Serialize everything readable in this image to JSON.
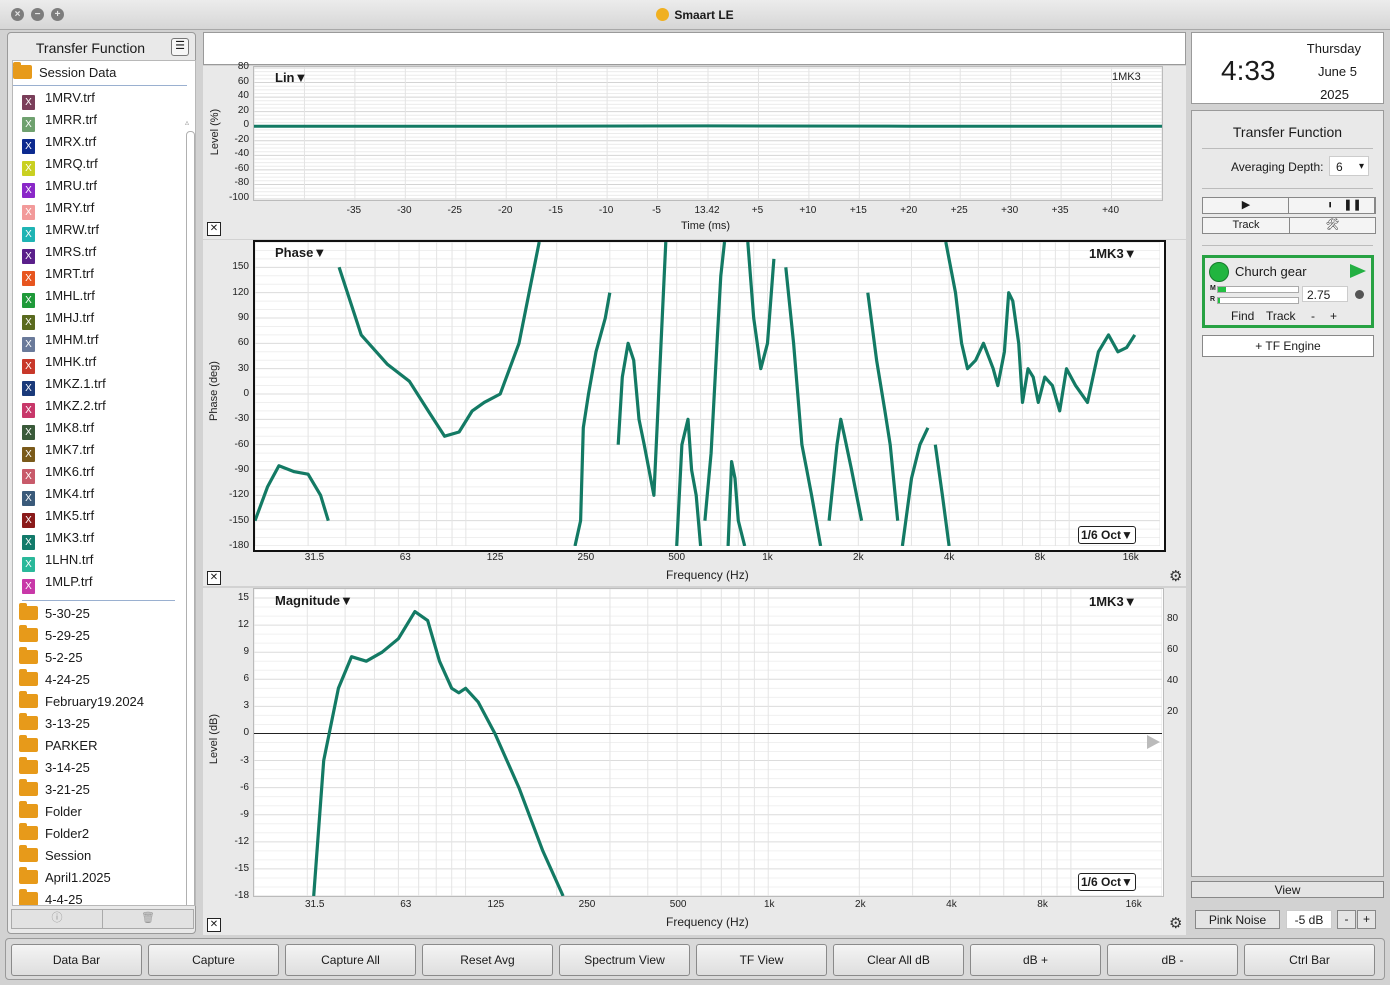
{
  "window": {
    "title": "Smaart LE"
  },
  "left_panel": {
    "title": "Transfer Function",
    "session_label": "Session Data",
    "files": [
      {
        "name": "1MRV.trf",
        "color": "#7a3e5a"
      },
      {
        "name": "1MRR.trf",
        "color": "#6fa16f"
      },
      {
        "name": "1MRX.trf",
        "color": "#0c2a8f"
      },
      {
        "name": "1MRQ.trf",
        "color": "#c9d021"
      },
      {
        "name": "1MRU.trf",
        "color": "#8a28c8"
      },
      {
        "name": "1MRY.trf",
        "color": "#f29a9a"
      },
      {
        "name": "1MRW.trf",
        "color": "#1fb4b4"
      },
      {
        "name": "1MRS.trf",
        "color": "#5a1f8a"
      },
      {
        "name": "1MRT.trf",
        "color": "#e7551f"
      },
      {
        "name": "1MHL.trf",
        "color": "#1f9a3a"
      },
      {
        "name": "1MHJ.trf",
        "color": "#5a6a1f"
      },
      {
        "name": "1MHM.trf",
        "color": "#6a7a9a"
      },
      {
        "name": "1MHK.trf",
        "color": "#c8382a"
      },
      {
        "name": "1MKZ.1.trf",
        "color": "#1a3a7a"
      },
      {
        "name": "1MKZ.2.trf",
        "color": "#c8386a"
      },
      {
        "name": "1MK8.trf",
        "color": "#3a5a3a"
      },
      {
        "name": "1MK7.trf",
        "color": "#7a5a1a"
      },
      {
        "name": "1MK6.trf",
        "color": "#c85a6a"
      },
      {
        "name": "1MK4.trf",
        "color": "#3a5a7a"
      },
      {
        "name": "1MK5.trf",
        "color": "#8a1a1a"
      },
      {
        "name": "1MK3.trf",
        "color": "#127a6a"
      },
      {
        "name": "1LHN.trf",
        "color": "#2ab89a"
      },
      {
        "name": "1MLP.trf",
        "color": "#c838a8"
      }
    ],
    "folders": [
      "5-30-25",
      "5-29-25",
      "5-2-25",
      "4-24-25",
      "February19.2024",
      "3-13-25",
      "PARKER",
      "3-14-25",
      "3-21-25",
      "Folder",
      "Folder2",
      "Session",
      "April1.2025",
      "4-4-25"
    ]
  },
  "live_plot": {
    "title": "Lin",
    "measurement_label": "1MK3",
    "y_label": "Level (%)",
    "x_label": "Time (ms)",
    "y_ticks": [
      "80",
      "60",
      "40",
      "20",
      "0",
      "-20",
      "-40",
      "-60",
      "-80",
      "-100"
    ],
    "x_ticks": [
      "-35",
      "-30",
      "-25",
      "-20",
      "-15",
      "-10",
      "-5",
      "13.42",
      "+5",
      "+10",
      "+15",
      "+20",
      "+25",
      "+30",
      "+35",
      "+40"
    ]
  },
  "phase_plot": {
    "title": "Phase",
    "measurement_label": "1MK3",
    "smoothing_label": "1/6 Oct",
    "y_label": "Phase (deg)",
    "x_label": "Frequency (Hz)",
    "y_ticks": [
      "150",
      "120",
      "90",
      "60",
      "30",
      "0",
      "-30",
      "-60",
      "-90",
      "-120",
      "-150",
      "-180"
    ],
    "x_ticks": [
      "31.5",
      "63",
      "125",
      "250",
      "500",
      "1k",
      "2k",
      "4k",
      "8k",
      "16k"
    ]
  },
  "mag_plot": {
    "title": "Magnitude",
    "measurement_label": "1MK3",
    "smoothing_label": "1/6 Oct",
    "y_label": "Level (dB)",
    "x_label": "Frequency (Hz)",
    "y_ticks": [
      "15",
      "12",
      "9",
      "6",
      "3",
      "0",
      "-3",
      "-6",
      "-9",
      "-12",
      "-15",
      "-18"
    ],
    "x_ticks": [
      "31.5",
      "63",
      "125",
      "250",
      "500",
      "1k",
      "2k",
      "4k",
      "8k",
      "16k"
    ],
    "right_ticks": [
      "80",
      "60",
      "40",
      "20"
    ]
  },
  "chart_data": [
    {
      "type": "line",
      "title": "Lin",
      "xlabel": "Time (ms)",
      "ylabel": "Level (%)",
      "ylim": [
        -100,
        80
      ],
      "series": [
        {
          "name": "1MK3",
          "x": [
            -40,
            -20,
            0,
            20,
            40
          ],
          "y": [
            0,
            0,
            0.5,
            0,
            0
          ]
        }
      ]
    },
    {
      "type": "line",
      "title": "Phase",
      "xlabel": "Frequency (Hz)",
      "ylabel": "Phase (deg)",
      "ylim": [
        -180,
        180
      ],
      "xscale": "log",
      "series": [
        {
          "name": "1MK3",
          "x": [
            20,
            22,
            24,
            27,
            30,
            33,
            35,
            38,
            45,
            55,
            65,
            75,
            85,
            95,
            105,
            115,
            130,
            150,
            175
          ],
          "y": [
            -150,
            -110,
            -85,
            -92,
            -95,
            -120,
            -150,
            150,
            70,
            35,
            15,
            -20,
            -50,
            -45,
            -20,
            -10,
            0,
            60,
            180
          ]
        }
      ]
    },
    {
      "type": "line",
      "title": "Magnitude",
      "xlabel": "Frequency (Hz)",
      "ylabel": "Level (dB)",
      "ylim": [
        -18,
        16
      ],
      "xscale": "log",
      "series": [
        {
          "name": "1MK3",
          "x": [
            31.5,
            34,
            38,
            42,
            47,
            53,
            60,
            68,
            75,
            82,
            90,
            95,
            100,
            110,
            125,
            150,
            180,
            210
          ],
          "y": [
            -18,
            -3,
            5,
            8.5,
            8,
            9,
            10.5,
            13.5,
            12.5,
            8,
            5,
            4.5,
            5,
            3.5,
            0,
            -6,
            -13,
            -18
          ]
        }
      ]
    }
  ],
  "clock": {
    "time": "4:33",
    "day": "Thursday",
    "date": "June 5",
    "year": "2025"
  },
  "right_panel": {
    "title": "Transfer Function",
    "averaging_label": "Averaging Depth:",
    "averaging_value": "6",
    "track_label": "Track",
    "measurement": {
      "name": "Church gear",
      "value": "2.75",
      "m_label": "M",
      "r_label": "R",
      "m_level": 0.1,
      "r_level": 0.03,
      "find_label": "Find",
      "track_label": "Track",
      "minus": "-",
      "plus": "+"
    },
    "tf_engine_label": "+ TF Engine",
    "view_label": "View",
    "pink_noise_label": "Pink Noise",
    "noise_level": "-5 dB",
    "noise_minus": "-",
    "noise_plus": "+"
  },
  "bottom_buttons": [
    "Data Bar",
    "Capture",
    "Capture All",
    "Reset Avg",
    "Spectrum View",
    "TF View",
    "Clear All dB",
    "dB +",
    "dB -",
    "Ctrl Bar"
  ],
  "colors": {
    "trace": "#137a64",
    "accent_green": "#27a243"
  }
}
